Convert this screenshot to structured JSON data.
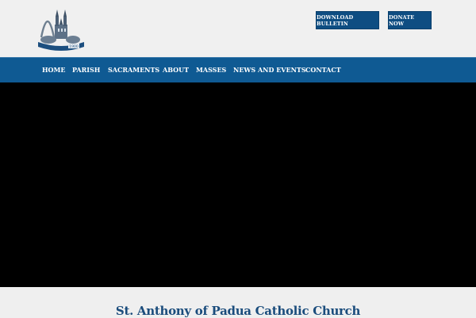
{
  "header": {
    "logo_text": "1900",
    "buttons": {
      "bulletin": "DOWNLOAD BULLETIN",
      "donate": "DONATE NOW"
    }
  },
  "nav": {
    "items": [
      "HOME",
      "PARISH",
      "SACRAMENTS",
      "ABOUT",
      "MASSES",
      "NEWS AND EVENTS",
      "CONTACT"
    ]
  },
  "main": {
    "title": "St. Anthony of Padua Catholic Church"
  },
  "colors": {
    "brand_blue": "#0f5a93",
    "button_blue": "#0e4d82",
    "title_blue": "#1a4c7c"
  }
}
